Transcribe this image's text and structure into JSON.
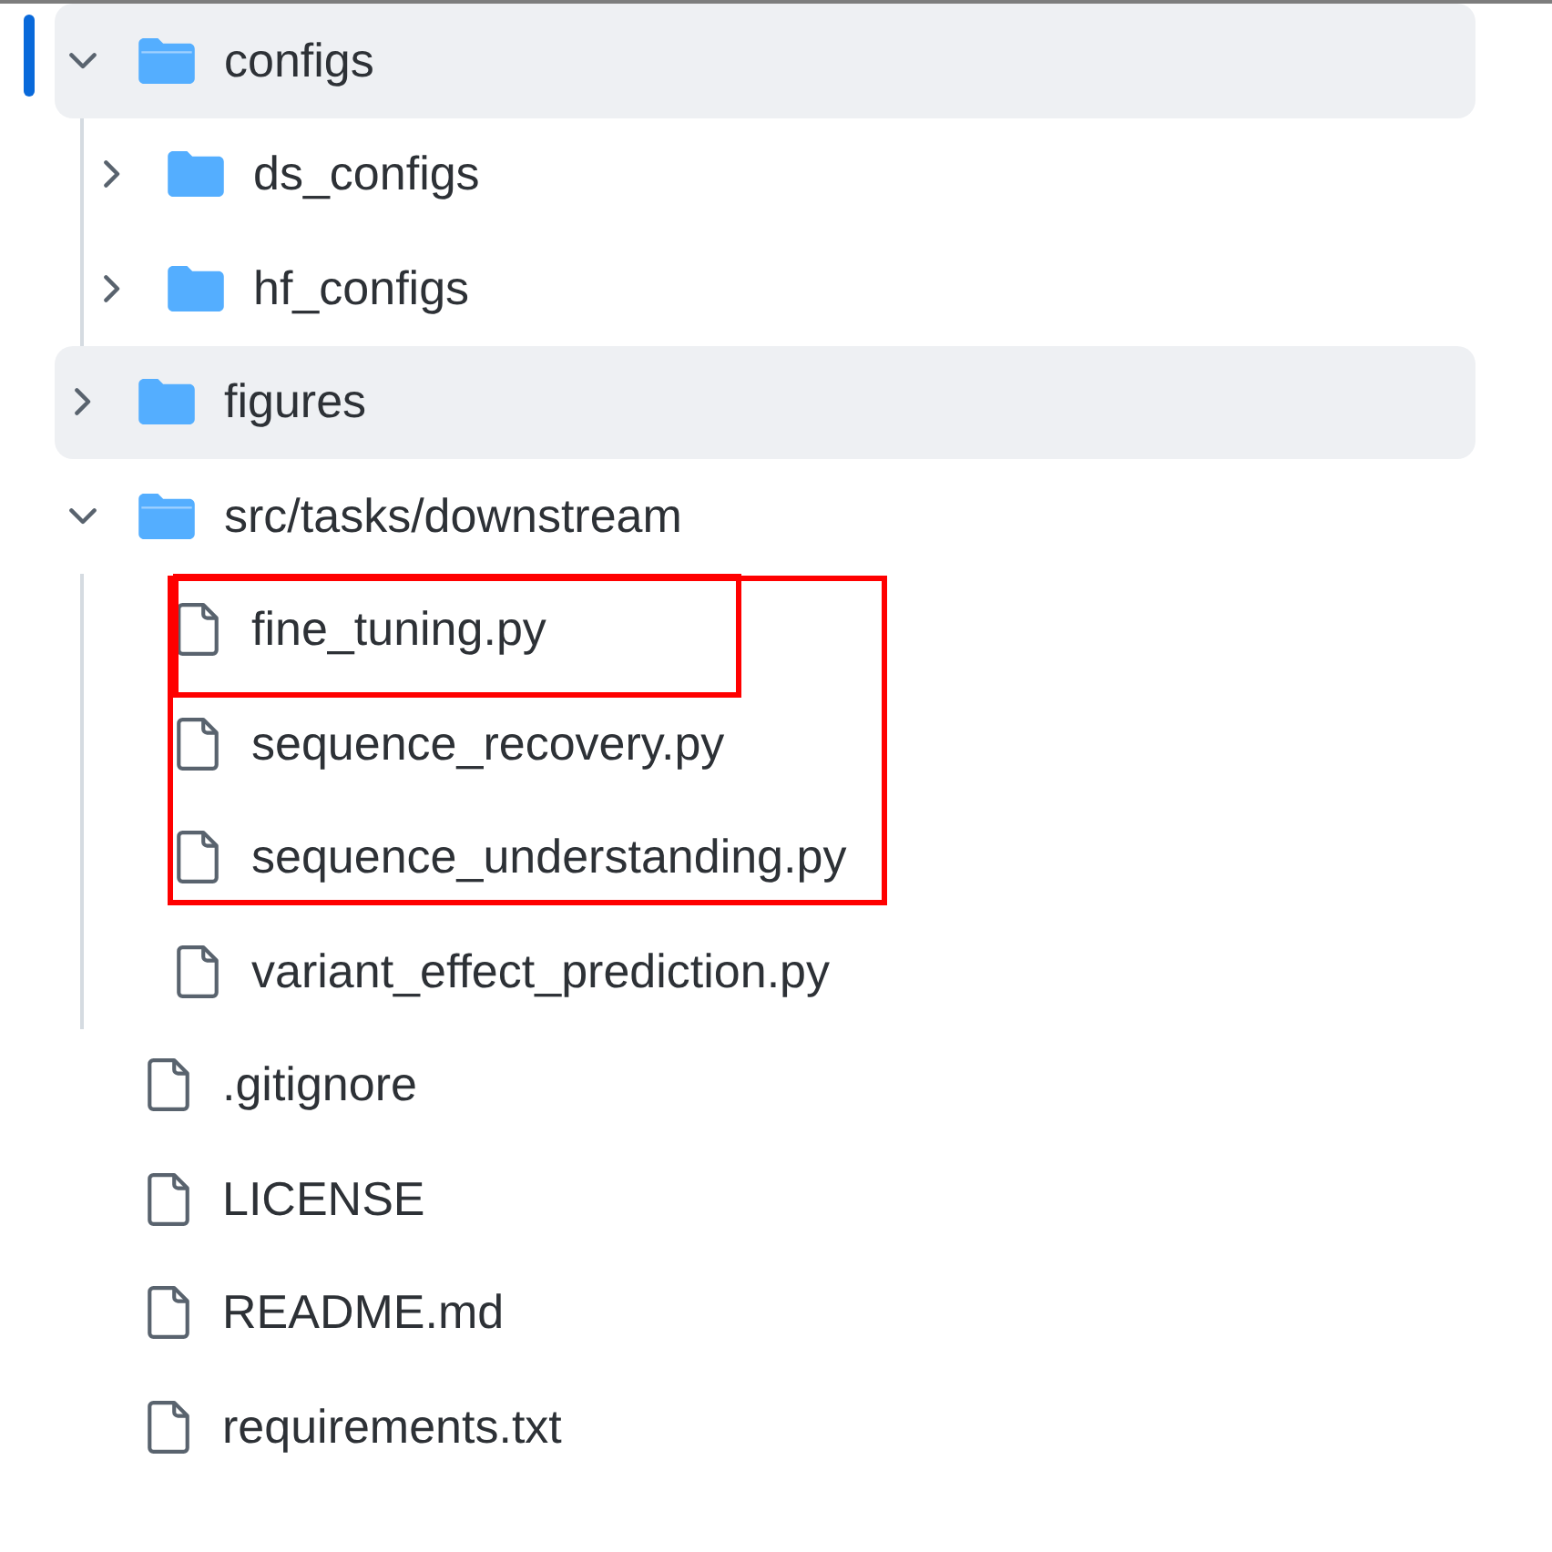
{
  "tree": {
    "items": [
      {
        "kind": "folder",
        "name": "configs",
        "expanded": true,
        "selected": true,
        "highlighted": true,
        "children": [
          {
            "kind": "folder",
            "name": "ds_configs",
            "expanded": false,
            "selected": false,
            "highlighted": false
          },
          {
            "kind": "folder",
            "name": "hf_configs",
            "expanded": false,
            "selected": false,
            "highlighted": false
          }
        ]
      },
      {
        "kind": "folder",
        "name": "figures",
        "expanded": false,
        "selected": false,
        "highlighted": true
      },
      {
        "kind": "folder",
        "name": "src/tasks/downstream",
        "expanded": true,
        "selected": false,
        "highlighted": false,
        "children": [
          {
            "kind": "file",
            "name": "fine_tuning.py",
            "selected": false,
            "highlighted": false,
            "marked": true,
            "marked_single": true
          },
          {
            "kind": "file",
            "name": "sequence_recovery.py",
            "selected": false,
            "highlighted": false,
            "marked": true,
            "marked_single": false
          },
          {
            "kind": "file",
            "name": "sequence_understanding.py",
            "selected": false,
            "highlighted": false,
            "marked": true,
            "marked_single": false
          },
          {
            "kind": "file",
            "name": "variant_effect_prediction.py",
            "selected": false,
            "highlighted": false,
            "marked": false,
            "marked_single": false
          }
        ]
      },
      {
        "kind": "file",
        "name": ".gitignore",
        "selected": false,
        "highlighted": false
      },
      {
        "kind": "file",
        "name": "LICENSE",
        "selected": false,
        "highlighted": false
      },
      {
        "kind": "file",
        "name": "README.md",
        "selected": false,
        "highlighted": false
      },
      {
        "kind": "file",
        "name": "requirements.txt",
        "selected": false,
        "highlighted": false
      }
    ]
  }
}
